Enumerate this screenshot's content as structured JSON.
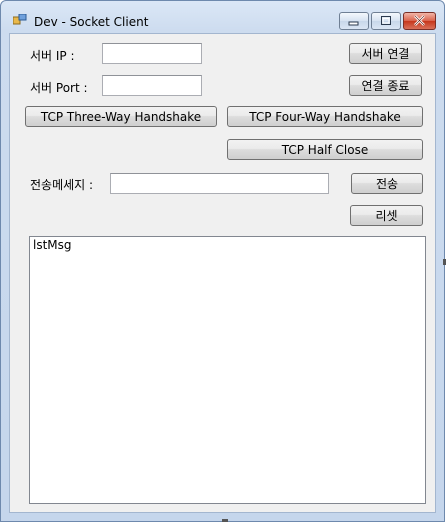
{
  "window": {
    "title": "Dev - Socket Client"
  },
  "form": {
    "server_ip_label": "서버 IP :",
    "server_ip_value": "",
    "server_port_label": "서버 Port :",
    "server_port_value": "",
    "connect_button": "서버 연결",
    "disconnect_button": "연결 종료",
    "three_way_button": "TCP Three-Way Handshake",
    "four_way_button": "TCP Four-Way Handshake",
    "half_close_button": "TCP Half Close",
    "message_label": "전송메세지 :",
    "message_value": "",
    "send_button": "전송",
    "reset_button": "리셋",
    "listbox_name": "lstMsg"
  },
  "icons": [
    "app-icon",
    "minimize-icon",
    "maximize-icon",
    "close-icon"
  ]
}
